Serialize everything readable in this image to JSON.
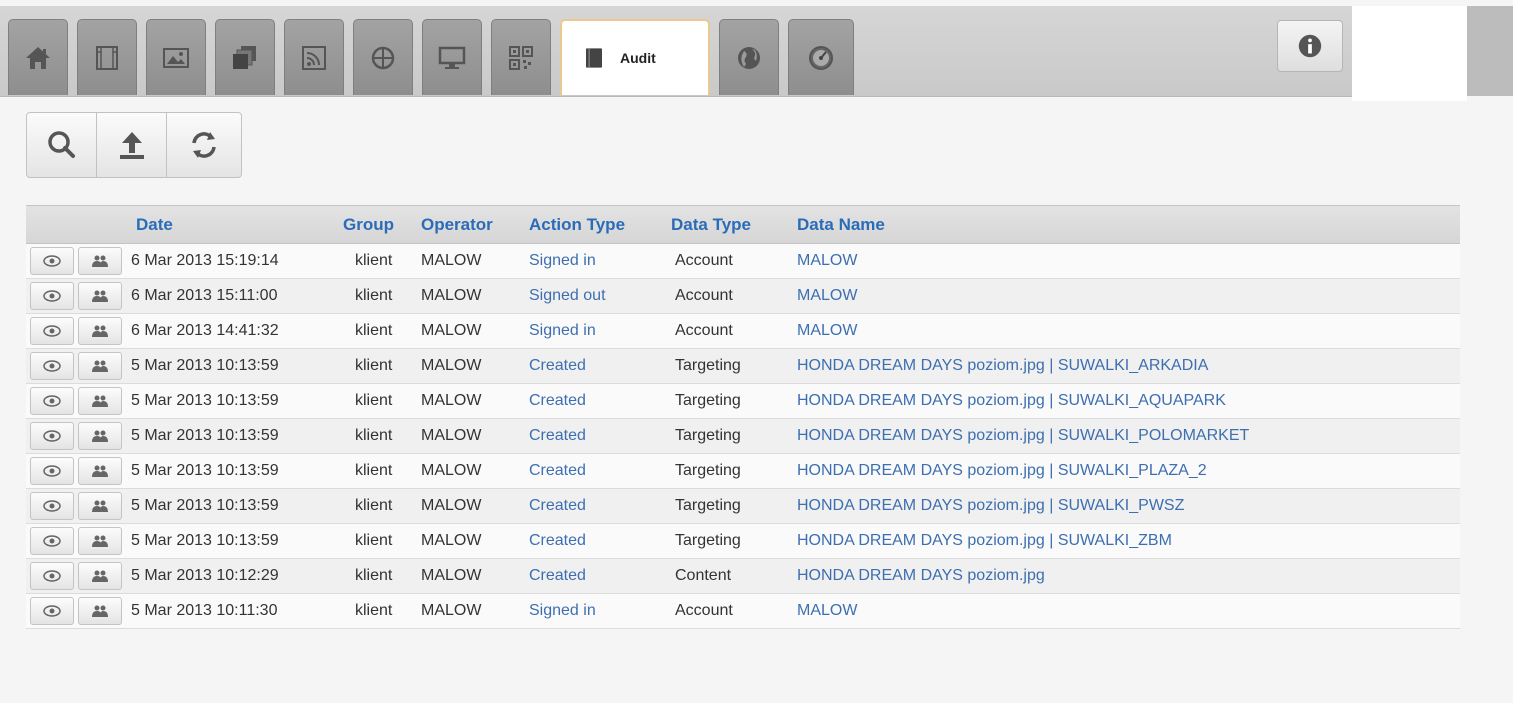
{
  "toolbar": {
    "tabs": [
      {
        "icon": "home-icon"
      },
      {
        "icon": "film-icon"
      },
      {
        "icon": "image-icon"
      },
      {
        "icon": "layers-icon"
      },
      {
        "icon": "rss-icon"
      },
      {
        "icon": "crosshair-icon"
      },
      {
        "icon": "monitor-icon"
      },
      {
        "icon": "qr-code-icon"
      },
      {
        "icon": "book-icon",
        "label": "Audit",
        "active": true
      },
      {
        "icon": "globe-icon"
      },
      {
        "icon": "gauge-icon"
      }
    ],
    "info_icon": "info-icon"
  },
  "actions": {
    "search_icon": "search-icon",
    "upload_icon": "upload-icon",
    "refresh_icon": "refresh-icon"
  },
  "table": {
    "columns": [
      "Date",
      "Group",
      "Operator",
      "Action Type",
      "Data Type",
      "Data Name"
    ],
    "rows": [
      {
        "date": "6 Mar 2013 15:19:14",
        "group": "klient",
        "operator": "MALOW",
        "action": "Signed in",
        "data_type": "Account",
        "data_name": "MALOW"
      },
      {
        "date": "6 Mar 2013 15:11:00",
        "group": "klient",
        "operator": "MALOW",
        "action": "Signed out",
        "data_type": "Account",
        "data_name": "MALOW"
      },
      {
        "date": "6 Mar 2013 14:41:32",
        "group": "klient",
        "operator": "MALOW",
        "action": "Signed in",
        "data_type": "Account",
        "data_name": "MALOW"
      },
      {
        "date": "5 Mar 2013 10:13:59",
        "group": "klient",
        "operator": "MALOW",
        "action": "Created",
        "data_type": "Targeting",
        "data_name": "HONDA DREAM DAYS poziom.jpg | SUWALKI_ARKADIA"
      },
      {
        "date": "5 Mar 2013 10:13:59",
        "group": "klient",
        "operator": "MALOW",
        "action": "Created",
        "data_type": "Targeting",
        "data_name": "HONDA DREAM DAYS poziom.jpg | SUWALKI_AQUAPARK"
      },
      {
        "date": "5 Mar 2013 10:13:59",
        "group": "klient",
        "operator": "MALOW",
        "action": "Created",
        "data_type": "Targeting",
        "data_name": "HONDA DREAM DAYS poziom.jpg | SUWALKI_POLOMARKET"
      },
      {
        "date": "5 Mar 2013 10:13:59",
        "group": "klient",
        "operator": "MALOW",
        "action": "Created",
        "data_type": "Targeting",
        "data_name": "HONDA DREAM DAYS poziom.jpg | SUWALKI_PLAZA_2"
      },
      {
        "date": "5 Mar 2013 10:13:59",
        "group": "klient",
        "operator": "MALOW",
        "action": "Created",
        "data_type": "Targeting",
        "data_name": "HONDA DREAM DAYS poziom.jpg | SUWALKI_PWSZ"
      },
      {
        "date": "5 Mar 2013 10:13:59",
        "group": "klient",
        "operator": "MALOW",
        "action": "Created",
        "data_type": "Targeting",
        "data_name": "HONDA DREAM DAYS poziom.jpg | SUWALKI_ZBM"
      },
      {
        "date": "5 Mar 2013 10:12:29",
        "group": "klient",
        "operator": "MALOW",
        "action": "Created",
        "data_type": "Content",
        "data_name": "HONDA DREAM DAYS poziom.jpg"
      },
      {
        "date": "5 Mar 2013 10:11:30",
        "group": "klient",
        "operator": "MALOW",
        "action": "Signed in",
        "data_type": "Account",
        "data_name": "MALOW"
      }
    ],
    "row_icons": [
      "eye-icon",
      "users-icon"
    ]
  }
}
